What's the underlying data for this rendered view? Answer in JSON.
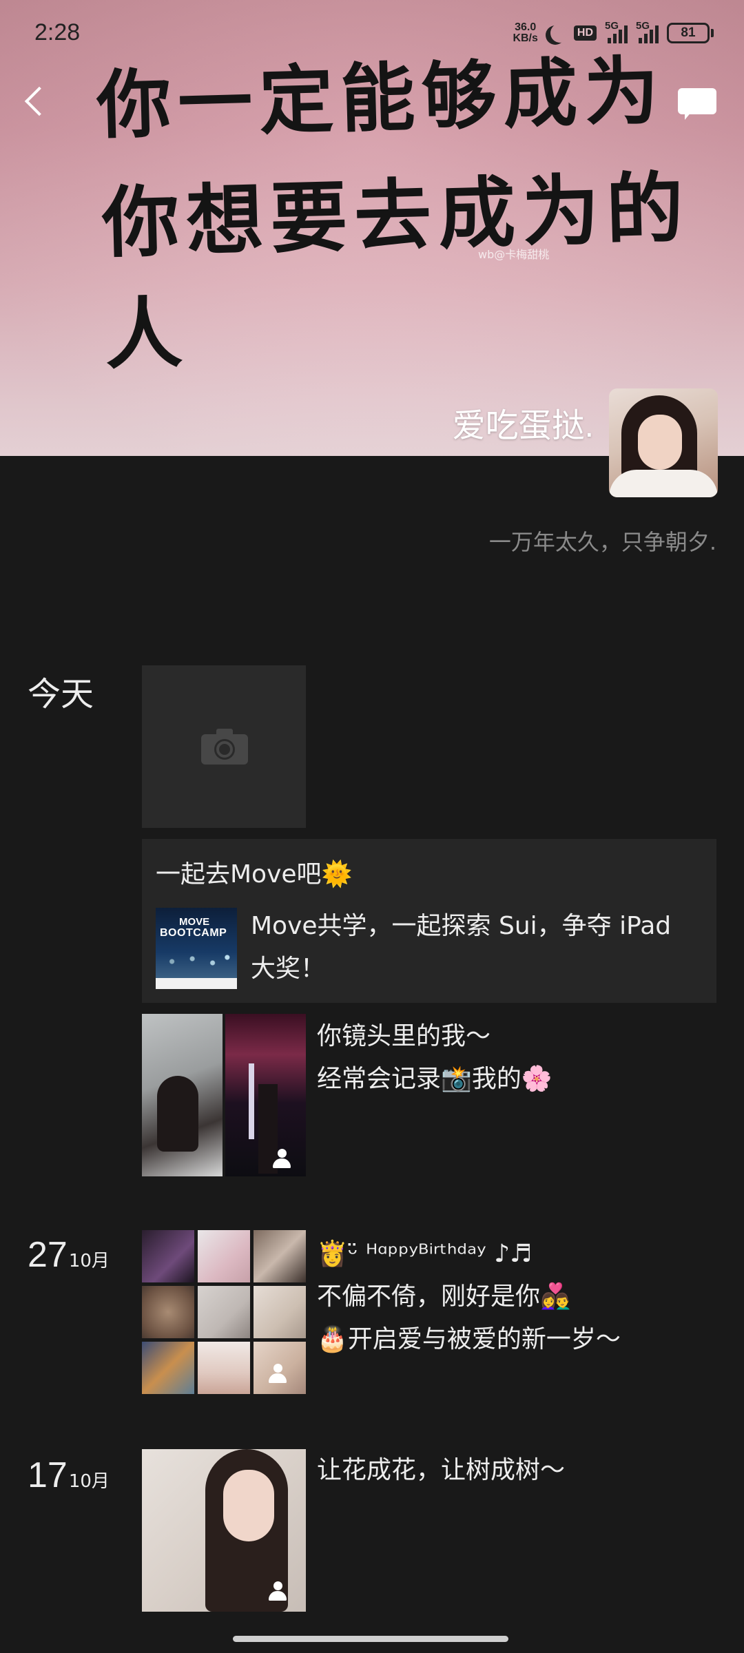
{
  "status_bar": {
    "time": "2:28",
    "net_speed_value": "36.0",
    "net_speed_unit": "KB/s",
    "hd_label": "HD",
    "signal_1_label": "5G",
    "signal_2_label": "5G",
    "battery": "81"
  },
  "cover": {
    "line1": "你一定能够成为",
    "line2": "你想要去成为的人",
    "watermark": "wb@卡梅甜桃"
  },
  "icons": {
    "back": "chevron-left-icon",
    "messages": "comment-icon",
    "camera": "camera-icon",
    "multi_photo": "person-icon"
  },
  "profile": {
    "name": "爱吃蛋挞.",
    "signature": "一万年太久，只争朝夕."
  },
  "feed": {
    "today": {
      "label": "今天",
      "share": {
        "title": "一起去Move吧🌞",
        "thumb_line1": "MOVE",
        "thumb_line2": "BOOTCAMP",
        "description": "Move共学，一起探索 Sui，争夺 iPad 大奖！"
      },
      "photo_post": {
        "line1": "你镜头里的我～",
        "line2": "经常会记录📸我的🌸"
      }
    },
    "oct27": {
      "day": "27",
      "month": "10月",
      "line1": "👸ᵕ̈ ᴴᵅᵖᵖʸᴮⁱʳᵗʰᵈᵃʸ ♪♬",
      "line2": "不偏不倚，刚好是你👩‍❤️‍👨",
      "line3": "🎂开启爱与被爱的新一岁～"
    },
    "oct17": {
      "day": "17",
      "month": "10月",
      "line1": "让花成花，让树成树～"
    }
  },
  "colors": {
    "background": "#191919",
    "card": "#262626",
    "text": "#ededed",
    "muted": "#8a8a8a"
  }
}
